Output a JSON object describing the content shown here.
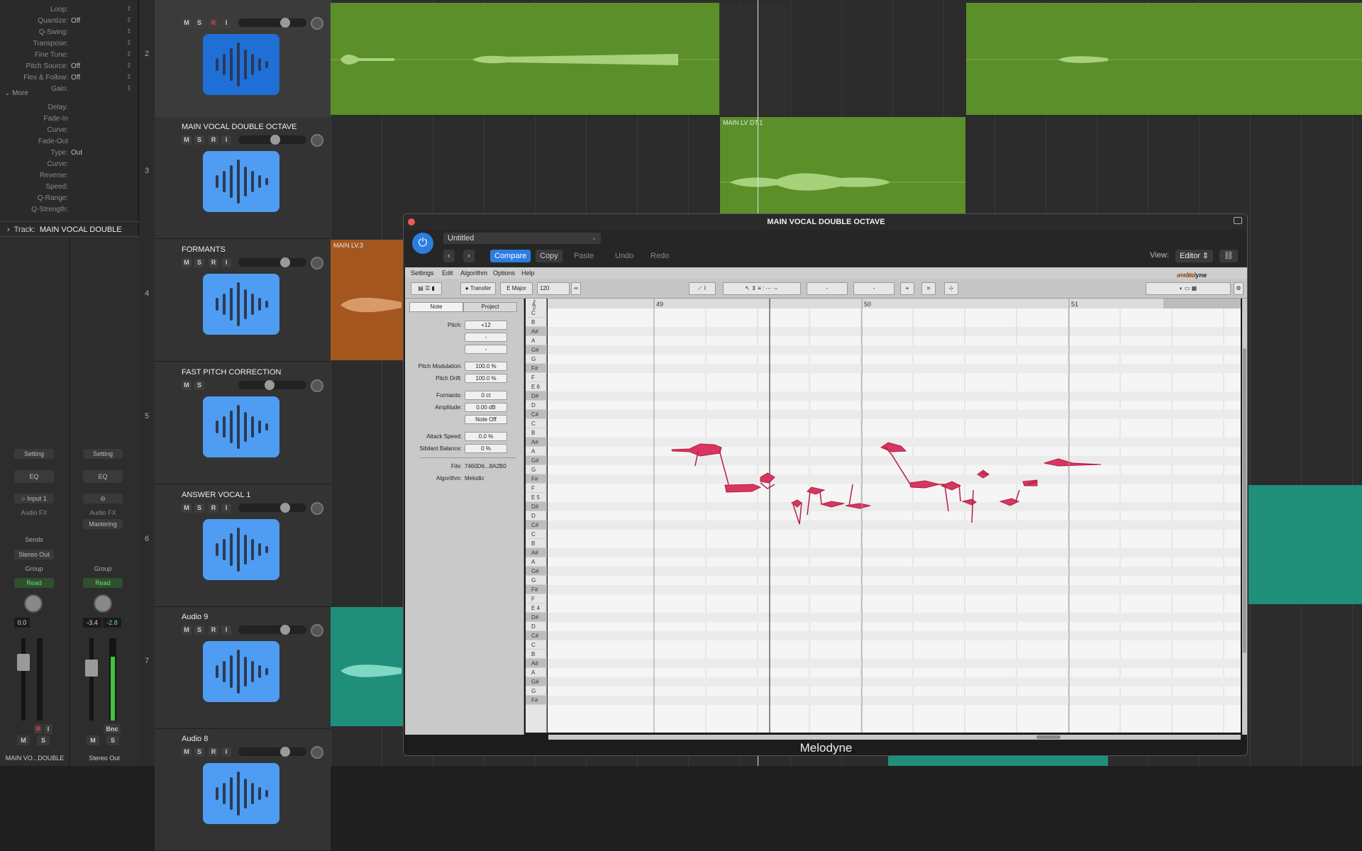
{
  "inspector": {
    "rows": [
      {
        "label": "Loop:",
        "value": ""
      },
      {
        "label": "Quantize:",
        "value": "Off"
      },
      {
        "label": "Q-Swing:",
        "value": ""
      },
      {
        "label": "Transpose:",
        "value": ""
      },
      {
        "label": "Fine Tune:",
        "value": ""
      },
      {
        "label": "Pitch Source:",
        "value": "Off"
      },
      {
        "label": "Flex & Follow:",
        "value": "Off"
      },
      {
        "label": "Gain:",
        "value": ""
      }
    ],
    "more_label": "More",
    "more_rows": [
      {
        "label": "Delay:",
        "value": ""
      },
      {
        "label": "Fade-In",
        "value": ""
      },
      {
        "label": "Curve:",
        "value": ""
      },
      {
        "label": "Fade-Out",
        "value": ""
      },
      {
        "label": "Type:",
        "value": "Out"
      },
      {
        "label": "Curve:",
        "value": ""
      },
      {
        "label": "Reverse:",
        "value": ""
      },
      {
        "label": "Speed:",
        "value": ""
      },
      {
        "label": "Q-Range:",
        "value": ""
      },
      {
        "label": "Q-Strength:",
        "value": ""
      }
    ],
    "track_section_label": "Track:",
    "track_section_name": "MAIN VOCAL DOUBLE",
    "strip_left": {
      "setting": "Setting",
      "eq": "EQ",
      "input": "Input 1",
      "audio_fx": "Audio FX",
      "sends": "Sends",
      "output": "Stereo Out",
      "group": "Group",
      "automation": "Read",
      "volume": "0.0",
      "m": "M",
      "s": "S",
      "r": "R",
      "i": "I",
      "name": "MAIN VO...DOUBLE"
    },
    "strip_right": {
      "setting": "Setting",
      "eq": "EQ",
      "audio_fx": "Audio FX",
      "mastering": "Mastering",
      "group": "Group",
      "automation": "Read",
      "volume": "-3.4",
      "peak": "-2.8",
      "bnc": "Bnc",
      "m": "M",
      "s": "S",
      "name": "Stereo Out"
    }
  },
  "tracks": [
    {
      "number": "2",
      "name": "",
      "m": "M",
      "s": "S",
      "r": "R",
      "i": "I",
      "volume_level": 0.72
    },
    {
      "number": "3",
      "name": "MAIN VOCAL DOUBLE OCTAVE",
      "m": "M",
      "s": "S",
      "r": "R",
      "i": "I",
      "volume_level": 0.55
    },
    {
      "number": "4",
      "name": "FORMANTS",
      "m": "M",
      "s": "S",
      "r": "R",
      "i": "I",
      "volume_level": 0.72
    },
    {
      "number": "5",
      "name": "FAST PITCH CORRECTION",
      "m": "M",
      "s": "S",
      "r": "",
      "i": "",
      "volume_level": 0.45
    },
    {
      "number": "6",
      "name": "ANSWER VOCAL 1",
      "m": "M",
      "s": "S",
      "r": "R",
      "i": "I",
      "volume_level": 0.72
    },
    {
      "number": "7",
      "name": "Audio 9",
      "m": "M",
      "s": "S",
      "r": "R",
      "i": "I",
      "volume_level": 0.72
    },
    {
      "number": "",
      "name": "Audio 8",
      "m": "M",
      "s": "S",
      "r": "R",
      "i": "I",
      "volume_level": 0.72
    }
  ],
  "regions": {
    "main_lv_dt": "MAIN LV DT.1",
    "main_lv3": "MAIN LV.3"
  },
  "melodyne": {
    "window_title": "MAIN VOCAL DOUBLE OCTAVE",
    "preset": "Untitled",
    "compare": "Compare",
    "copy": "Copy",
    "paste": "Paste",
    "undo": "Undo",
    "redo": "Redo",
    "view_label": "View:",
    "view_value": "Editor",
    "menu": [
      "Settings",
      "Edit",
      "Algorithm",
      "Options",
      "Help"
    ],
    "brand": "melodyne",
    "brand_edition": "studio",
    "transfer": "Transfer",
    "scale": "E Major",
    "tempo": "120",
    "tab_note": "Note",
    "tab_project": "Project",
    "panel": {
      "pitch_label": "Pitch:",
      "pitch_value": "+12",
      "pitch_b": "-",
      "pitch_c": "-",
      "pitch_mod_label": "Pitch Modulation:",
      "pitch_mod_value": "100.0 %",
      "pitch_drift_label": "Pitch Drift:",
      "pitch_drift_value": "100.0 %",
      "formants_label": "Formants:",
      "formants_value": "0 ct",
      "amplitude_label": "Amplitude:",
      "amplitude_value": "0.00 dB",
      "note_off": "Note Off",
      "attack_label": "Attack Speed:",
      "attack_value": "0.0 %",
      "sibilant_label": "Sibilant Balance:",
      "sibilant_value": "0 %",
      "file_label": "File:",
      "file_value": "7460D6...8A2B0",
      "algorithm_label": "Algorithm:",
      "algorithm_value": "Melodic"
    },
    "bars": [
      "49",
      "50",
      "51"
    ],
    "keys": [
      "C",
      "B",
      "A#",
      "A",
      "G#",
      "G",
      "F#",
      "F",
      "E 6",
      "D#",
      "D",
      "C#",
      "C",
      "B",
      "A#",
      "A",
      "G#",
      "G",
      "F#",
      "F",
      "E 5",
      "D#",
      "D",
      "C#",
      "C",
      "B",
      "A#",
      "A",
      "G#",
      "G",
      "F#",
      "F",
      "E 4",
      "D#",
      "D",
      "C#",
      "C",
      "B",
      "A#",
      "A",
      "G#",
      "G",
      "F#"
    ],
    "footer": "Melodyne"
  },
  "colors": {
    "green_region": "#5b8f2a",
    "orange_region": "#a4561f",
    "teal_region": "#1f8f7a",
    "blob": "#d7375e",
    "accent_blue": "#2c7de0"
  }
}
